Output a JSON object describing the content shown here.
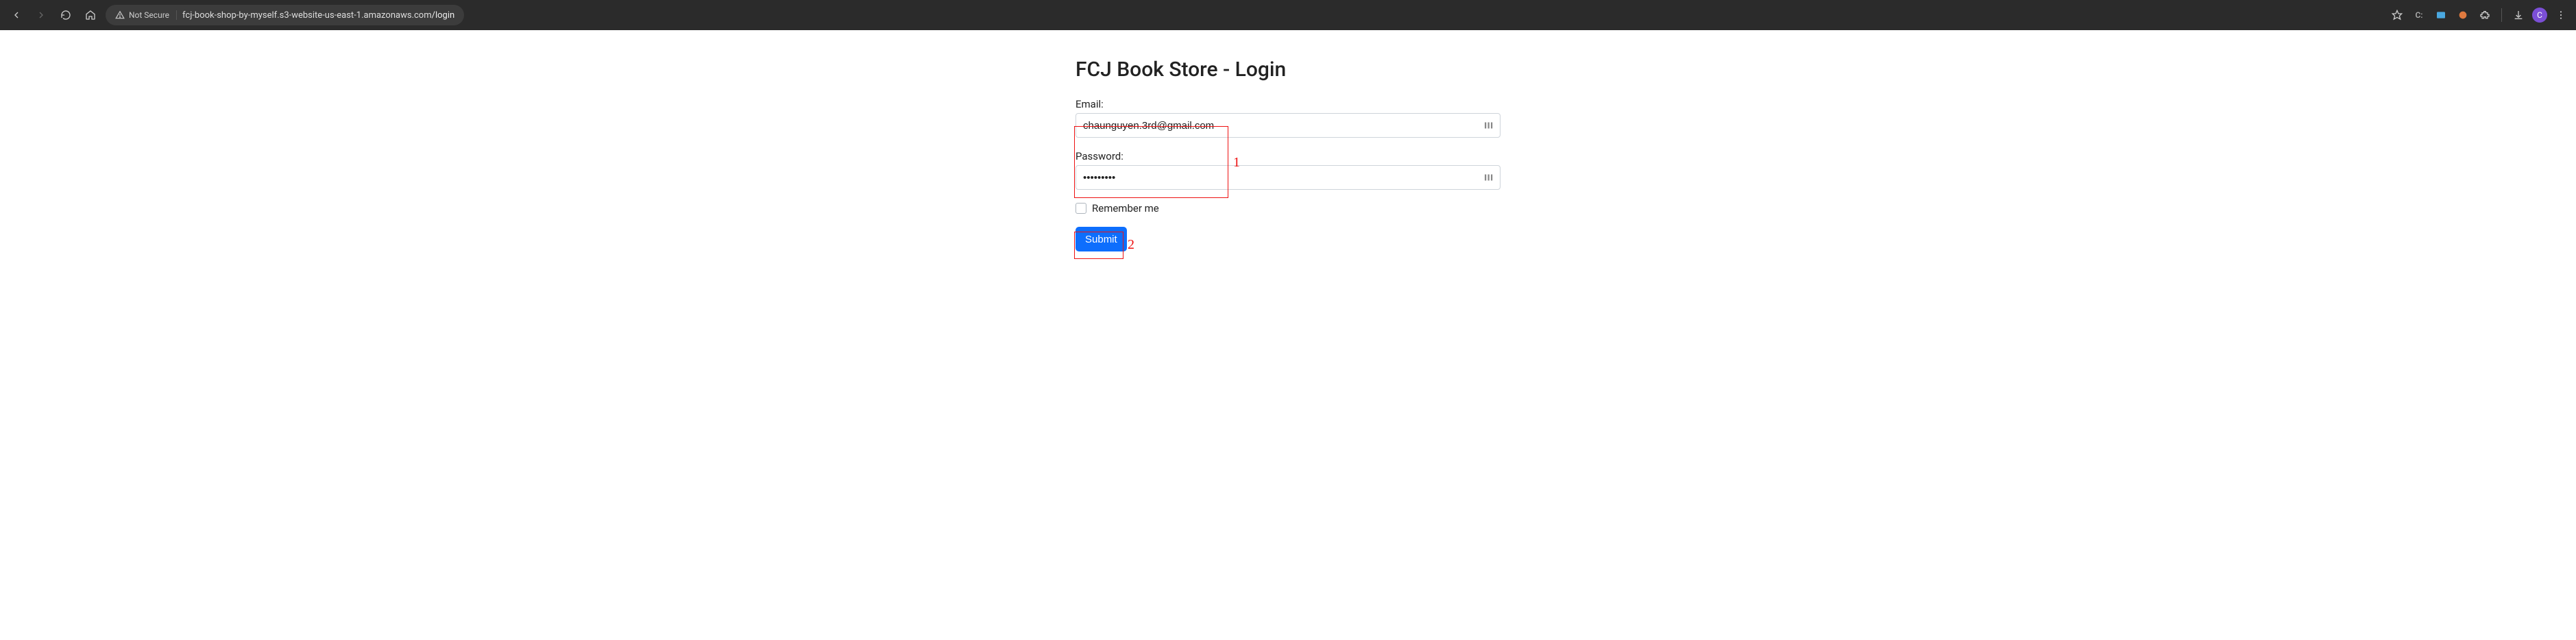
{
  "browser": {
    "not_secure_label": "Not Secure",
    "url_host": "fcj-book-shop-by-myself.s3-website-us-east-1.amazonaws.com",
    "url_path": "/login",
    "profile_letter": "C"
  },
  "page": {
    "title": "FCJ Book Store - Login",
    "email_label": "Email:",
    "email_value": "chaunguyen.3rd@gmail.com",
    "password_label": "Password:",
    "password_value": "•••••••••",
    "remember_label": "Remember me",
    "submit_label": "Submit"
  },
  "annotations": {
    "box1_num": "1",
    "box2_num": "2"
  }
}
